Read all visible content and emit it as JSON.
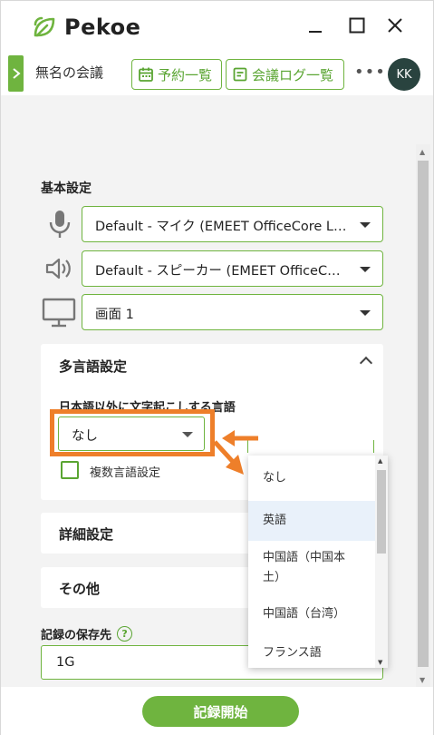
{
  "app": {
    "name": "Pekoe",
    "brand_color": "#6fb43f"
  },
  "window_controls": {
    "minimize": "_",
    "maximize": "□",
    "close": "✕"
  },
  "toolbar": {
    "meeting_name": "無名の会議",
    "reserve_label": "予約一覧",
    "log_label": "会議ログ一覧",
    "more_label": "•••",
    "avatar_initials": "KK"
  },
  "basic_settings": {
    "title": "基本設定",
    "mic": "Default - マイク (EMEET OfficeCore L…",
    "speaker": "Default - スピーカー (EMEET OfficeC…",
    "screen": "画面 1"
  },
  "multilang": {
    "title": "多言語設定",
    "subtitle": "日本語以外に文字起こしする言語",
    "selected": "なし",
    "checkbox_label": "複数言語設定",
    "checkbox_checked": false
  },
  "detail_settings": {
    "title": "詳細設定"
  },
  "other": {
    "title": "その他"
  },
  "save_location": {
    "label": "記録の保存先",
    "help": "?",
    "value": "1G"
  },
  "dropdown": {
    "options": [
      "なし",
      "英語",
      "中国語（中国本土）",
      "中国語（台湾）",
      "フランス語"
    ],
    "option_lines": [
      [
        "なし"
      ],
      [
        "英語"
      ],
      [
        "中国語（中国本",
        "土）"
      ],
      [
        "中国語（台湾）"
      ],
      [
        "フランス語"
      ]
    ],
    "highlighted": "英語"
  },
  "record_button": "記録開始",
  "annotation_color": "#ee7f2a"
}
